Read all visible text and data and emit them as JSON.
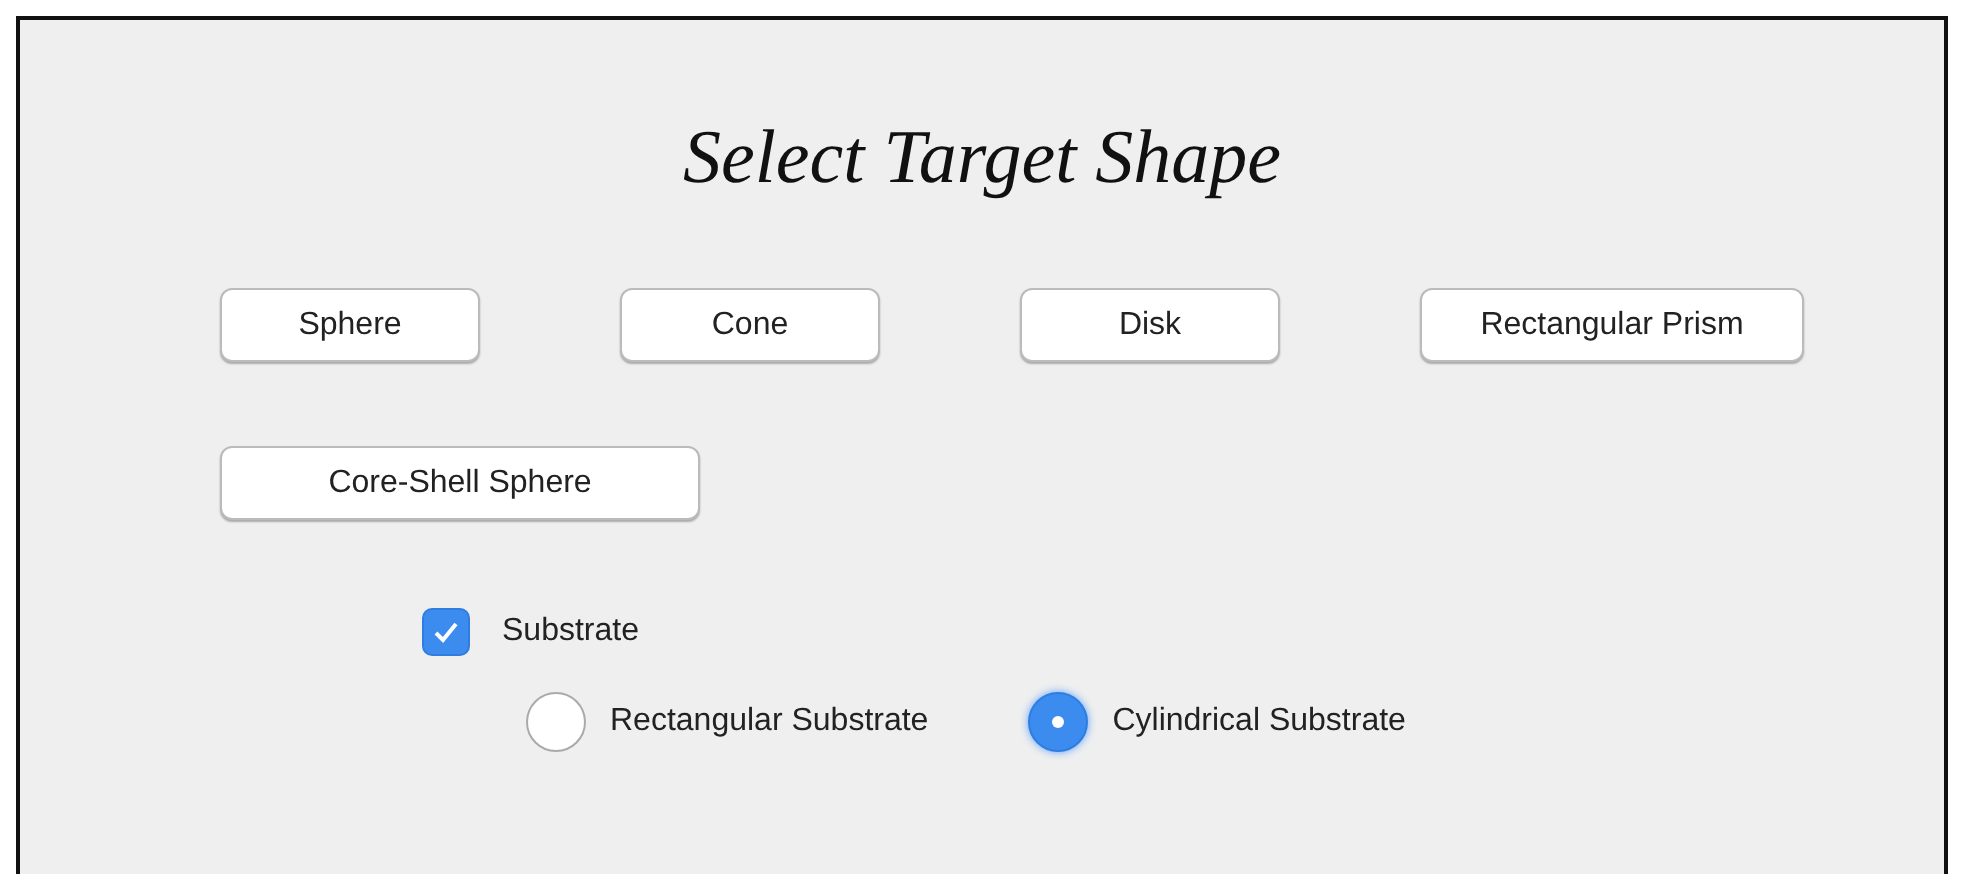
{
  "title": "Select Target Shape",
  "shape_buttons": [
    {
      "label": "Sphere"
    },
    {
      "label": "Cone"
    },
    {
      "label": "Disk"
    },
    {
      "label": "Rectangular Prism"
    },
    {
      "label": "Core-Shell Sphere"
    }
  ],
  "substrate": {
    "label": "Substrate",
    "checked": true
  },
  "substrate_types": [
    {
      "label": "Rectangular Substrate",
      "selected": false
    },
    {
      "label": "Cylindrical Substrate",
      "selected": true
    }
  ]
}
